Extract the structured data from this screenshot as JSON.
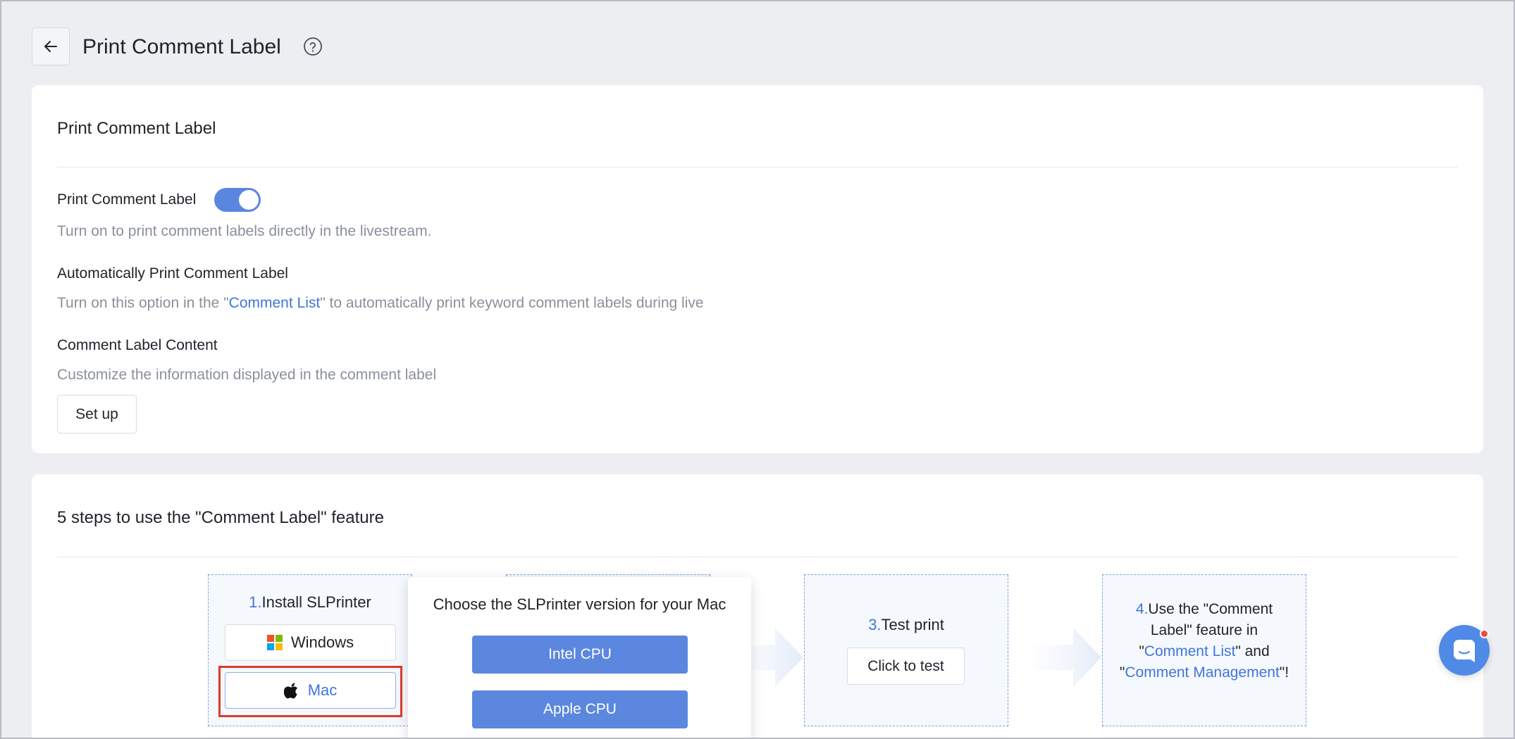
{
  "header": {
    "title": "Print Comment Label",
    "back_icon": "arrow-left-icon",
    "help_icon": "question-circle-icon"
  },
  "settings_card": {
    "title": "Print Comment Label",
    "print_label": {
      "label": "Print Comment Label",
      "enabled": true,
      "description": "Turn on to print comment labels directly in the livestream."
    },
    "auto_print": {
      "label": "Automatically Print Comment Label",
      "desc_prefix": "Turn on this option in the \"",
      "desc_link": "Comment List",
      "desc_suffix": "\" to automatically print keyword comment labels during live"
    },
    "label_content": {
      "label": "Comment Label Content",
      "description": "Customize the information displayed in the comment label",
      "button": "Set up"
    }
  },
  "steps_card": {
    "title": "5 steps to use the \"Comment Label\" feature",
    "step1": {
      "num": "1.",
      "title": "Install SLPrinter",
      "windows_label": "Windows",
      "mac_label": "Mac"
    },
    "step3": {
      "num": "3.",
      "title": "Test print",
      "button": "Click to test"
    },
    "step4": {
      "num": "4.",
      "text_a": "Use the \"Comment Label\" feature in \"",
      "link_a": "Comment List",
      "text_b": "\" and \"",
      "link_b": "Comment Management",
      "text_c": "\"!"
    }
  },
  "mac_popover": {
    "title": "Choose the SLPrinter version for your Mac",
    "intel_button": "Intel CPU",
    "apple_button": "Apple CPU"
  },
  "colors": {
    "accent": "#5b87df",
    "link": "#3f76d9",
    "highlight": "#dc3b2c"
  }
}
